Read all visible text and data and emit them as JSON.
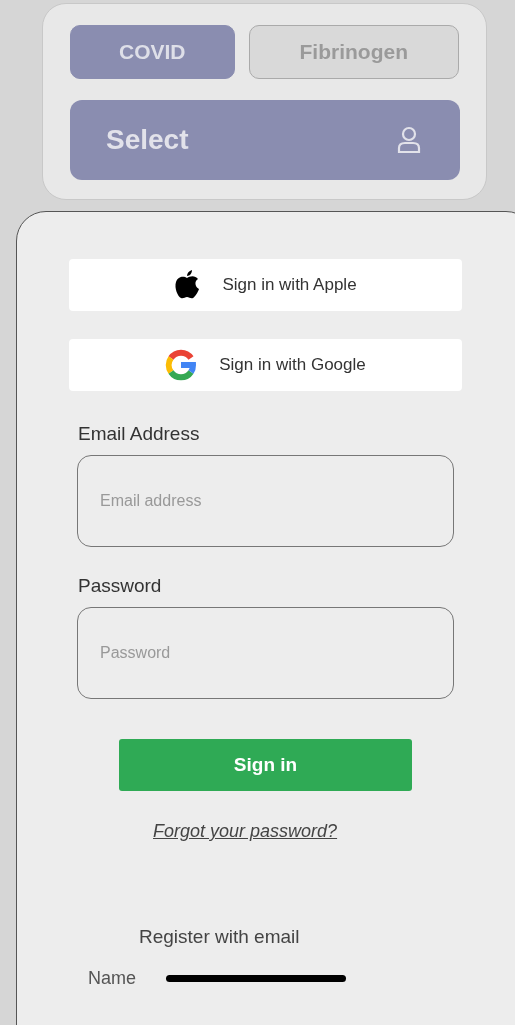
{
  "tabs": [
    {
      "label": "COVID",
      "selected": true
    },
    {
      "label": "Fibrinogen",
      "selected": false
    }
  ],
  "select_button": {
    "label": "Select"
  },
  "social_buttons": [
    {
      "kind": "apple",
      "label": "Sign in with Apple"
    },
    {
      "kind": "google",
      "label": "Sign in with Google"
    }
  ],
  "fields": [
    {
      "label": "Email Address",
      "placeholder": "Email address"
    },
    {
      "label": "Password",
      "placeholder": "Password"
    }
  ],
  "sign_in_button": "Sign in",
  "forgot_link": "Forgot your password?",
  "register_heading": "Register with email",
  "name_label": "Name"
}
